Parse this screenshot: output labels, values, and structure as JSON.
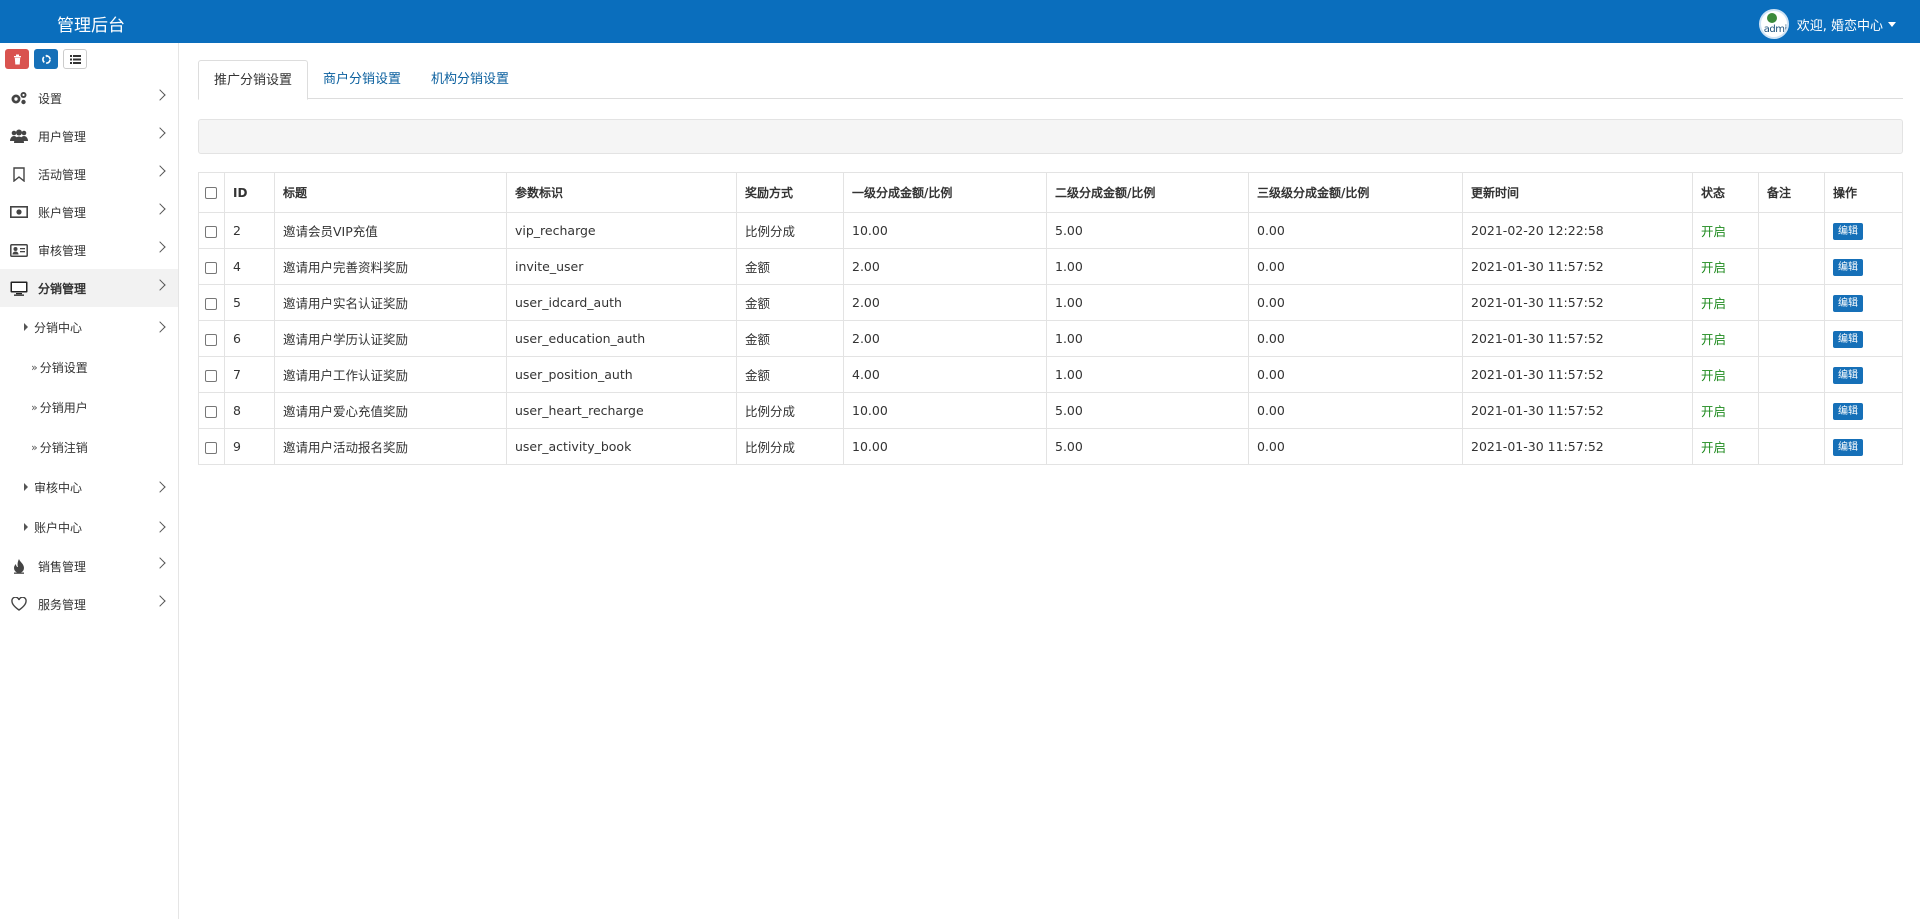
{
  "header": {
    "brand": "管理后台",
    "avatar_text": "admi",
    "welcome": "欢迎, 婚恋中心"
  },
  "colors": {
    "primary": "#0a6ebd",
    "danger": "#d9534f",
    "success": "#1e8a1e"
  },
  "sidebar": {
    "tools": [
      {
        "icon": "trash-icon"
      },
      {
        "icon": "recycle-icon"
      },
      {
        "icon": "list-icon"
      }
    ],
    "items": [
      {
        "label": "设置",
        "icon": "gears-icon"
      },
      {
        "label": "用户管理",
        "icon": "users-icon"
      },
      {
        "label": "活动管理",
        "icon": "bookmark-icon"
      },
      {
        "label": "账户管理",
        "icon": "money-icon"
      },
      {
        "label": "审核管理",
        "icon": "id-card-icon"
      },
      {
        "label": "分销管理",
        "icon": "monitor-icon"
      },
      {
        "label": "销售管理",
        "icon": "fire-icon"
      },
      {
        "label": "服务管理",
        "icon": "heart-icon"
      }
    ],
    "sub": {
      "fenxiao_center": "分销中心",
      "fenxiao_children": [
        "分销设置",
        "分销用户",
        "分销注销"
      ],
      "shenhe_center": "审核中心",
      "zhanghu_center": "账户中心"
    }
  },
  "tabs": [
    "推广分销设置",
    "商户分销设置",
    "机构分销设置"
  ],
  "table": {
    "headers": [
      "ID",
      "标题",
      "参数标识",
      "奖励方式",
      "一级分成金额/比例",
      "二级分成金额/比例",
      "三级级分成金额/比例",
      "更新时间",
      "状态",
      "备注",
      "操作"
    ],
    "rows": [
      {
        "id": "2",
        "title": "邀请会员VIP充值",
        "key": "vip_recharge",
        "mode": "比例分成",
        "l1": "10.00",
        "l2": "5.00",
        "l3": "0.00",
        "time": "2021-02-20 12:22:58",
        "status": "开启",
        "note": "",
        "action": "编辑"
      },
      {
        "id": "4",
        "title": "邀请用户完善资料奖励",
        "key": "invite_user",
        "mode": "金额",
        "l1": "2.00",
        "l2": "1.00",
        "l3": "0.00",
        "time": "2021-01-30 11:57:52",
        "status": "开启",
        "note": "",
        "action": "编辑"
      },
      {
        "id": "5",
        "title": "邀请用户实名认证奖励",
        "key": "user_idcard_auth",
        "mode": "金额",
        "l1": "2.00",
        "l2": "1.00",
        "l3": "0.00",
        "time": "2021-01-30 11:57:52",
        "status": "开启",
        "note": "",
        "action": "编辑"
      },
      {
        "id": "6",
        "title": "邀请用户学历认证奖励",
        "key": "user_education_auth",
        "mode": "金额",
        "l1": "2.00",
        "l2": "1.00",
        "l3": "0.00",
        "time": "2021-01-30 11:57:52",
        "status": "开启",
        "note": "",
        "action": "编辑"
      },
      {
        "id": "7",
        "title": "邀请用户工作认证奖励",
        "key": "user_position_auth",
        "mode": "金额",
        "l1": "4.00",
        "l2": "1.00",
        "l3": "0.00",
        "time": "2021-01-30 11:57:52",
        "status": "开启",
        "note": "",
        "action": "编辑"
      },
      {
        "id": "8",
        "title": "邀请用户爱心充值奖励",
        "key": "user_heart_recharge",
        "mode": "比例分成",
        "l1": "10.00",
        "l2": "5.00",
        "l3": "0.00",
        "time": "2021-01-30 11:57:52",
        "status": "开启",
        "note": "",
        "action": "编辑"
      },
      {
        "id": "9",
        "title": "邀请用户活动报名奖励",
        "key": "user_activity_book",
        "mode": "比例分成",
        "l1": "10.00",
        "l2": "5.00",
        "l3": "0.00",
        "time": "2021-01-30 11:57:52",
        "status": "开启",
        "note": "",
        "action": "编辑"
      }
    ]
  }
}
